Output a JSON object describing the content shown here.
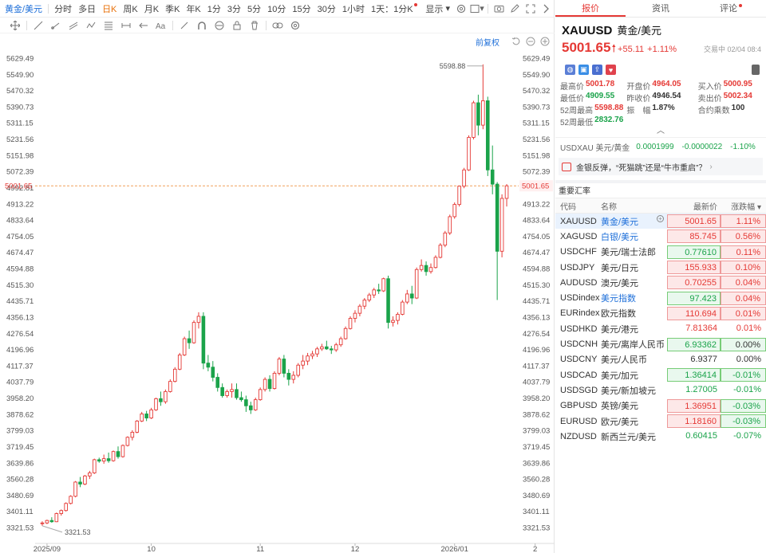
{
  "toolbar": {
    "symbol": "黄金/美元",
    "periods": [
      "分时",
      "多日",
      "日K",
      "周K",
      "月K",
      "季K",
      "年K",
      "1分",
      "3分",
      "5分",
      "10分",
      "15分",
      "30分",
      "1小时"
    ],
    "active_period": "日K",
    "multi_view": "1天：1分K",
    "display_label": "显示"
  },
  "chart_controls": {
    "adjust_label": "前复权"
  },
  "chart_data": {
    "type": "candlestick",
    "symbol": "XAUUSD",
    "y_ticks": [
      5629.49,
      5549.9,
      5470.32,
      5390.73,
      5311.15,
      5231.56,
      5151.98,
      5072.39,
      4992.81,
      4913.22,
      4833.64,
      4754.05,
      4674.47,
      4594.88,
      4515.3,
      4435.71,
      4356.13,
      4276.54,
      4196.96,
      4117.37,
      4037.79,
      3958.2,
      3878.62,
      3799.03,
      3719.45,
      3639.86,
      3560.28,
      3480.69,
      3401.11,
      3321.53
    ],
    "ylim": [
      3300,
      5640
    ],
    "x_labels": [
      "2025/09",
      "10",
      "11",
      "12",
      "2026/01",
      "2"
    ],
    "x_label_index": [
      1,
      23,
      46,
      66,
      87,
      104
    ],
    "current_price": 5001.65,
    "max_label": "5598.88",
    "min_label": "3321.53",
    "up_color": "#e53935",
    "down_color": "#1aa34a",
    "ohlc": [
      [
        3340,
        3352,
        3330,
        3344
      ],
      [
        3344,
        3360,
        3338,
        3356
      ],
      [
        3356,
        3372,
        3345,
        3350
      ],
      [
        3350,
        3395,
        3348,
        3390
      ],
      [
        3390,
        3410,
        3380,
        3405
      ],
      [
        3405,
        3445,
        3400,
        3440
      ],
      [
        3440,
        3480,
        3435,
        3475
      ],
      [
        3475,
        3550,
        3470,
        3545
      ],
      [
        3545,
        3570,
        3520,
        3535
      ],
      [
        3535,
        3580,
        3530,
        3575
      ],
      [
        3575,
        3600,
        3560,
        3590
      ],
      [
        3590,
        3660,
        3585,
        3655
      ],
      [
        3655,
        3665,
        3640,
        3648
      ],
      [
        3648,
        3680,
        3635,
        3660
      ],
      [
        3660,
        3690,
        3640,
        3650
      ],
      [
        3650,
        3700,
        3645,
        3695
      ],
      [
        3695,
        3720,
        3660,
        3670
      ],
      [
        3670,
        3730,
        3665,
        3725
      ],
      [
        3725,
        3770,
        3720,
        3765
      ],
      [
        3765,
        3800,
        3750,
        3790
      ],
      [
        3790,
        3850,
        3785,
        3845
      ],
      [
        3845,
        3890,
        3840,
        3880
      ],
      [
        3880,
        3895,
        3845,
        3860
      ],
      [
        3860,
        3910,
        3855,
        3900
      ],
      [
        3900,
        3960,
        3895,
        3955
      ],
      [
        3955,
        3990,
        3920,
        3940
      ],
      [
        3940,
        4000,
        3930,
        3990
      ],
      [
        3990,
        4050,
        3985,
        4040
      ],
      [
        4040,
        4110,
        4035,
        4100
      ],
      [
        4100,
        4180,
        4095,
        4170
      ],
      [
        4170,
        4260,
        4165,
        4250
      ],
      [
        4250,
        4290,
        4200,
        4230
      ],
      [
        4230,
        4340,
        4225,
        4330
      ],
      [
        4330,
        4380,
        4300,
        4360
      ],
      [
        4360,
        4380,
        4100,
        4130
      ],
      [
        4130,
        4170,
        4090,
        4110
      ],
      [
        4110,
        4140,
        4040,
        4060
      ],
      [
        4060,
        4080,
        3990,
        4010
      ],
      [
        4010,
        4030,
        3960,
        3970
      ],
      [
        3970,
        4000,
        3960,
        3990
      ],
      [
        3990,
        4030,
        3960,
        4000
      ],
      [
        4000,
        4030,
        3950,
        3960
      ],
      [
        3960,
        3990,
        3940,
        3950
      ],
      [
        3950,
        3970,
        3890,
        3920
      ],
      [
        3920,
        3940,
        3880,
        3900
      ],
      [
        3900,
        3960,
        3895,
        3950
      ],
      [
        3950,
        4010,
        3945,
        4000
      ],
      [
        4000,
        4060,
        3990,
        4050
      ],
      [
        4050,
        4070,
        3990,
        4005
      ],
      [
        4005,
        4090,
        4000,
        4080
      ],
      [
        4080,
        4160,
        4070,
        4150
      ],
      [
        4150,
        4170,
        4060,
        4080
      ],
      [
        4080,
        4100,
        4020,
        4050
      ],
      [
        4050,
        4090,
        4030,
        4070
      ],
      [
        4070,
        4130,
        4060,
        4120
      ],
      [
        4120,
        4170,
        4100,
        4140
      ],
      [
        4140,
        4180,
        4120,
        4165
      ],
      [
        4165,
        4190,
        4150,
        4175
      ],
      [
        4175,
        4210,
        4160,
        4200
      ],
      [
        4200,
        4225,
        4190,
        4210
      ],
      [
        4210,
        4240,
        4195,
        4200
      ],
      [
        4200,
        4215,
        4175,
        4195
      ],
      [
        4195,
        4230,
        4185,
        4220
      ],
      [
        4220,
        4260,
        4210,
        4250
      ],
      [
        4250,
        4310,
        4245,
        4300
      ],
      [
        4300,
        4360,
        4295,
        4350
      ],
      [
        4350,
        4390,
        4330,
        4375
      ],
      [
        4375,
        4420,
        4360,
        4410
      ],
      [
        4410,
        4450,
        4395,
        4440
      ],
      [
        4440,
        4475,
        4430,
        4465
      ],
      [
        4465,
        4500,
        4450,
        4490
      ],
      [
        4490,
        4520,
        4470,
        4485
      ],
      [
        4485,
        4550,
        4480,
        4545
      ],
      [
        4545,
        4560,
        4300,
        4330
      ],
      [
        4330,
        4360,
        4310,
        4340
      ],
      [
        4340,
        4380,
        4320,
        4370
      ],
      [
        4370,
        4440,
        4365,
        4430
      ],
      [
        4430,
        4490,
        4420,
        4470
      ],
      [
        4470,
        4510,
        4420,
        4450
      ],
      [
        4450,
        4600,
        4445,
        4590
      ],
      [
        4590,
        4640,
        4580,
        4610
      ],
      [
        4610,
        4630,
        4560,
        4580
      ],
      [
        4580,
        4620,
        4570,
        4600
      ],
      [
        4600,
        4660,
        4595,
        4650
      ],
      [
        4650,
        4720,
        4645,
        4710
      ],
      [
        4710,
        4780,
        4700,
        4770
      ],
      [
        4770,
        4860,
        4760,
        4850
      ],
      [
        4850,
        4920,
        4840,
        4910
      ],
      [
        4910,
        5000,
        4900,
        5000
      ],
      [
        5000,
        5090,
        4990,
        5080
      ],
      [
        5080,
        5250,
        5075,
        5240
      ],
      [
        5240,
        5420,
        5230,
        5410
      ],
      [
        5410,
        5450,
        5250,
        5300
      ],
      [
        5300,
        5598.88,
        5280,
        5420
      ],
      [
        5420,
        5440,
        5050,
        5080
      ],
      [
        5080,
        5200,
        4960,
        5010
      ],
      [
        5010,
        5020,
        4440,
        4680
      ],
      [
        4680,
        4960,
        4650,
        4940
      ],
      [
        4940,
        5010,
        4900,
        5001.65
      ]
    ]
  },
  "quote": {
    "tabs": [
      "报价",
      "资讯",
      "评论"
    ],
    "code": "XAUUSD",
    "name": "黄金/美元",
    "price": "5001.65",
    "change": "+55.11",
    "change_pct": "+1.11%",
    "status": "交易中 02/04 08:4",
    "stats": [
      [
        {
          "k": "最高价",
          "v": "5001.78",
          "c": "up"
        },
        {
          "k": "开盘价",
          "v": "4964.05",
          "c": "up"
        },
        {
          "k": "买入价",
          "v": "5000.95",
          "c": "up"
        }
      ],
      [
        {
          "k": "最低价",
          "v": "4909.55",
          "c": "down"
        },
        {
          "k": "昨收价",
          "v": "4946.54",
          "c": "neutral"
        },
        {
          "k": "卖出价",
          "v": "5002.34",
          "c": "up"
        }
      ],
      [
        {
          "k": "52周最高",
          "v": "5598.88",
          "c": "up"
        },
        {
          "k": "振　幅",
          "v": "1.87%",
          "c": "neutral"
        },
        {
          "k": "合约乘数",
          "v": "100",
          "c": "neutral"
        }
      ],
      [
        {
          "k": "52周最低",
          "v": "2832.76",
          "c": "down"
        }
      ]
    ],
    "usdxau": {
      "code": "USDXAU",
      "name": "美元/黄金",
      "price": "0.0001999",
      "change": "-0.0000022",
      "pct": "-1.10%"
    },
    "news": "金银反弹，“死猫跳”还是“牛市重启”？"
  },
  "rates": {
    "title": "重要汇率",
    "headers": {
      "code": "代码",
      "name": "名称",
      "last": "最新价",
      "chg": "涨跌幅"
    },
    "rows": [
      {
        "code": "XAUUSD",
        "name": "黄金/美元",
        "last": "5001.65",
        "chg": "1.11%",
        "dir": "up",
        "box": true,
        "blue": true,
        "sel": true
      },
      {
        "code": "XAGUSD",
        "name": "白银/美元",
        "last": "85.745",
        "chg": "0.56%",
        "dir": "up",
        "box": true,
        "blue": true
      },
      {
        "code": "USDCHF",
        "name": "美元/瑞士法郎",
        "last": "0.77610",
        "chg": "0.11%",
        "dir": "down",
        "box": true,
        "chgdir": "down"
      },
      {
        "code": "USDJPY",
        "name": "美元/日元",
        "last": "155.933",
        "chg": "0.10%",
        "dir": "up",
        "box": true
      },
      {
        "code": "AUDUSD",
        "name": "澳元/美元",
        "last": "0.70255",
        "chg": "0.04%",
        "dir": "up",
        "box": true
      },
      {
        "code": "USDindex",
        "name": "美元指数",
        "last": "97.423",
        "chg": "0.04%",
        "dir": "down",
        "box": true,
        "blue": true,
        "chgdir": "down"
      },
      {
        "code": "EURindex",
        "name": "欧元指数",
        "last": "110.694",
        "chg": "0.01%",
        "dir": "up",
        "box": true
      },
      {
        "code": "USDHKD",
        "name": "美元/港元",
        "last": "7.81364",
        "chg": "0.01%",
        "dir": "up",
        "box": false
      },
      {
        "code": "USDCNH",
        "name": "美元/离岸人民币",
        "last": "6.93362",
        "chg": "0.00%",
        "dir": "down",
        "box": true,
        "chgdir": "neutral"
      },
      {
        "code": "USDCNY",
        "name": "美元/人民币",
        "last": "6.9377",
        "chg": "0.00%",
        "dir": "neutral",
        "box": false
      },
      {
        "code": "USDCAD",
        "name": "美元/加元",
        "last": "1.36414",
        "chg": "-0.01%",
        "dir": "down",
        "box": true
      },
      {
        "code": "USDSGD",
        "name": "美元/新加坡元",
        "last": "1.27005",
        "chg": "-0.01%",
        "dir": "down",
        "box": false
      },
      {
        "code": "GBPUSD",
        "name": "英镑/美元",
        "last": "1.36951",
        "chg": "-0.03%",
        "dir": "up",
        "box": true,
        "chgdir": "up"
      },
      {
        "code": "EURUSD",
        "name": "欧元/美元",
        "last": "1.18160",
        "chg": "-0.03%",
        "dir": "up",
        "box": true,
        "chgdir": "up"
      },
      {
        "code": "NZDUSD",
        "name": "新西兰元/美元",
        "last": "0.60415",
        "chg": "-0.07%",
        "dir": "down",
        "box": false
      }
    ]
  }
}
